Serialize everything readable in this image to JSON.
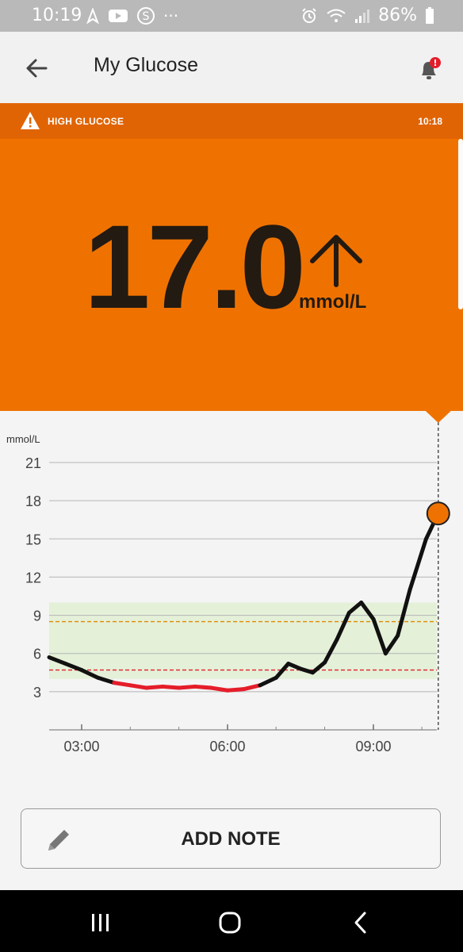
{
  "status": {
    "time": "10:19",
    "battery": "86%",
    "overflow": "···"
  },
  "appbar": {
    "title": "My Glucose"
  },
  "alert": {
    "label": "HIGH GLUCOSE",
    "time": "10:18"
  },
  "reading": {
    "value": "17.0",
    "unit": "mmol/L",
    "trend": "rising"
  },
  "chart_data": {
    "type": "line",
    "ylabel": "mmol/L",
    "y_ticks": [
      "21",
      "18",
      "15",
      "12",
      "9",
      "6",
      "3"
    ],
    "x_ticks": [
      "03:00",
      "06:00",
      "09:00"
    ],
    "ylim": [
      0,
      21
    ],
    "target_range": [
      4,
      10
    ],
    "high_threshold": 8.5,
    "low_threshold": 4.7,
    "series": [
      {
        "x": [
          "02:20",
          "02:40",
          "03:00",
          "03:20",
          "03:40",
          "04:00",
          "04:20",
          "04:40",
          "05:00",
          "05:20",
          "05:40",
          "06:00",
          "06:20",
          "06:40",
          "07:00",
          "07:15",
          "07:30",
          "07:45",
          "08:00",
          "08:15",
          "08:30",
          "08:45",
          "09:00",
          "09:15",
          "09:30",
          "09:45",
          "10:05",
          "10:20"
        ],
        "values": [
          5.7,
          5.2,
          4.7,
          4.1,
          3.7,
          3.5,
          3.3,
          3.4,
          3.3,
          3.4,
          3.3,
          3.1,
          3.2,
          3.5,
          4.1,
          5.2,
          4.8,
          4.5,
          5.3,
          7.1,
          9.2,
          10.0,
          8.7,
          6.0,
          7.4,
          11.0,
          15.0,
          17.0
        ]
      }
    ],
    "current_point": {
      "x": "10:20",
      "value": 17.0
    }
  },
  "note_button": {
    "label": "ADD NOTE"
  },
  "colors": {
    "alert": "#e06404",
    "reading_bg": "#ef7200",
    "low_line": "#e51d2a",
    "current_dot": "#ef7200",
    "target_band": "#e4f0d8"
  }
}
